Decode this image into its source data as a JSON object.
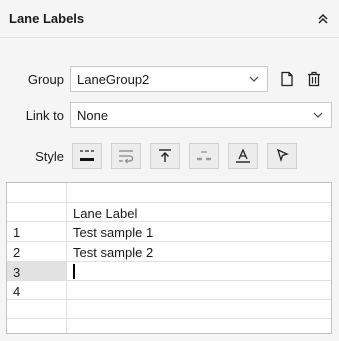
{
  "header": {
    "title": "Lane Labels"
  },
  "group": {
    "label": "Group",
    "value": "LaneGroup2"
  },
  "link": {
    "label": "Link to",
    "value": "None"
  },
  "style": {
    "label": "Style"
  },
  "table": {
    "column_header": "Lane Label",
    "rows": [
      {
        "num": "1",
        "label": "Test sample 1"
      },
      {
        "num": "2",
        "label": "Test sample 2"
      },
      {
        "num": "3",
        "label": ""
      },
      {
        "num": "4",
        "label": ""
      }
    ],
    "selected_row": "3"
  },
  "icons": {
    "collapse": "chevron-double-up-icon",
    "new": "new-document-icon",
    "delete": "trash-icon"
  }
}
